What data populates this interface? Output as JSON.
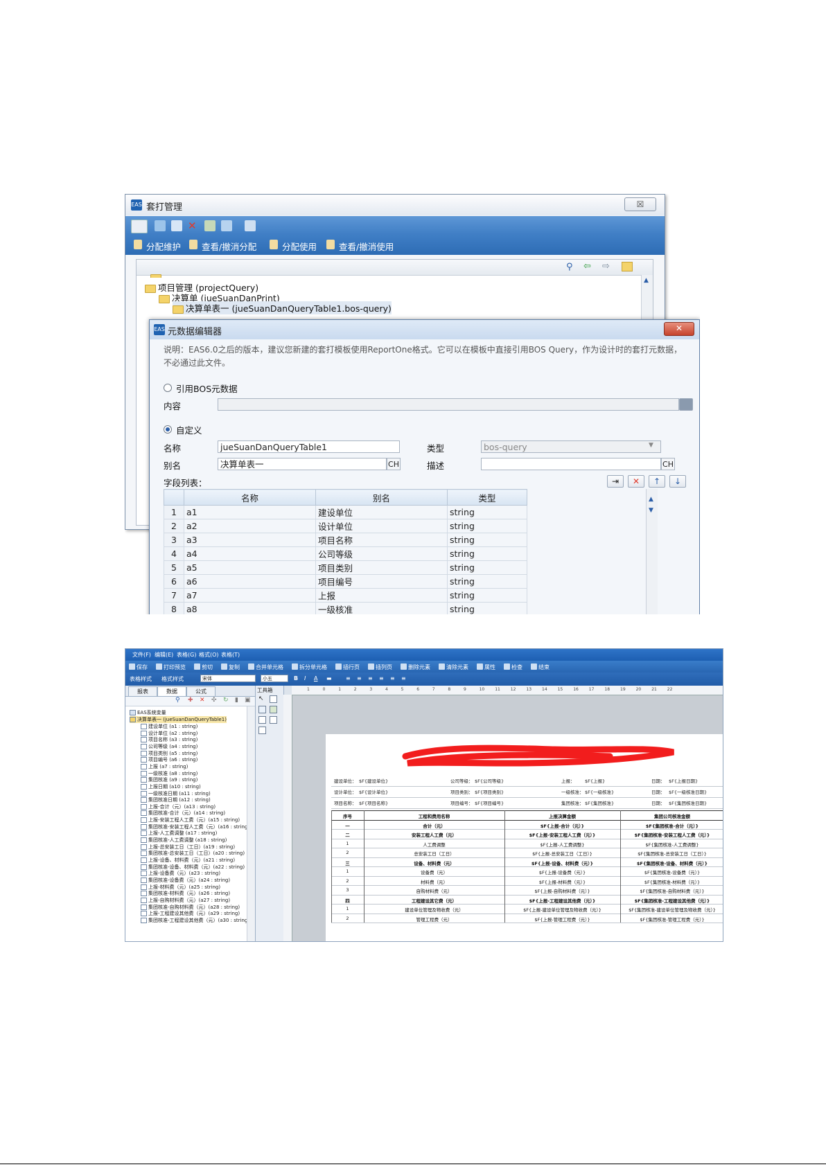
{
  "win1": {
    "title": "套打管理",
    "close": "☒",
    "actions": [
      "分配维护",
      "查看/撤消分配",
      "分配使用",
      "查看/撤消使用"
    ],
    "tree": [
      {
        "indent": 0,
        "label": "项目管理 (projectQuery)"
      },
      {
        "indent": 1,
        "label": "决算单 (jueSuanDanPrint)"
      },
      {
        "indent": 2,
        "label": "决算单表一 (jueSuanDanQueryTable1.bos-query)",
        "selected": true
      }
    ]
  },
  "dialog": {
    "title": "元数据编辑器",
    "description": "说明：EAS6.0之后的版本，建议您新建的套打模板使用ReportOne格式。它可以在模板中直接引用BOS Query，作为设计时的套打元数据，不必通过此文件。",
    "ref_bos_label": "引用BOS元数据",
    "content_label": "内容",
    "custom_label": "自定义",
    "name_label": "名称",
    "name_value": "jueSuanDanQueryTable1",
    "type_label": "类型",
    "type_value": "bos-query",
    "alias_label": "别名",
    "alias_value": "决算单表一",
    "desc_label": "描述",
    "ch": "CH",
    "fields_label": "字段列表：",
    "columns": [
      "名称",
      "别名",
      "类型"
    ],
    "rows": [
      [
        "1",
        "a1",
        "建设单位",
        "string"
      ],
      [
        "2",
        "a2",
        "设计单位",
        "string"
      ],
      [
        "3",
        "a3",
        "项目名称",
        "string"
      ],
      [
        "4",
        "a4",
        "公司等级",
        "string"
      ],
      [
        "5",
        "a5",
        "项目类别",
        "string"
      ],
      [
        "6",
        "a6",
        "项目编号",
        "string"
      ],
      [
        "7",
        "a7",
        "上报",
        "string"
      ],
      [
        "8",
        "a8",
        "一级核准",
        "string"
      ]
    ]
  },
  "editor": {
    "menus": [
      "文件(F)",
      "编辑(E)",
      "表格(G)",
      "格式(O)",
      "表格(T)"
    ],
    "toolbar1": [
      "保存",
      "打印预览",
      "剪切",
      "复制",
      "合并单元格",
      "拆分单元格",
      "插行页",
      "插列页",
      "删除元素",
      "清除元素",
      "属性",
      "检查",
      "结束"
    ],
    "toolbar2": {
      "style": "表格样式",
      "brush": "格式样式",
      "font": "宋体",
      "size": "小五"
    },
    "left_tabs": [
      "报表",
      "数据",
      "公式"
    ],
    "toolbox_label": "工具箱",
    "tree_root": "EAS系统变量",
    "tree_table": "决算单表一 (jueSuanDanQueryTable1)",
    "tree_items": [
      "建设单位 (a1 : string)",
      "设计单位 (a2 : string)",
      "项目名称 (a3 : string)",
      "公司等级 (a4 : string)",
      "项目类别 (a5 : string)",
      "项目编号 (a6 : string)",
      "上报 (a7 : string)",
      "一级核准 (a8 : string)",
      "集团核准 (a9 : string)",
      "上报日期 (a10 : string)",
      "一级核准日期 (a11 : string)",
      "集团核准日期 (a12 : string)",
      "上报-合计（元）(a13 : string)",
      "集团核准-合计（元）(a14 : string)",
      "上报-安装工程人工费（元）(a15 : string)",
      "集团核准-安装工程人工费（元）(a16 : string)",
      "上报-人工费调整 (a17 : string)",
      "集团核准-人工费调整 (a18 : string)",
      "上报-总安装工日（工日）(a19 : string)",
      "集团核准-总安装工日（工日）(a20 : string)",
      "上报-设备、材料费（元）(a21 : string)",
      "集团核准-设备、材料费（元）(a22 : string)",
      "上报-设备费（元）(a23 : string)",
      "集团核准-设备费（元）(a24 : string)",
      "上报-材料费（元）(a25 : string)",
      "集团核准-材料费（元）(a26 : string)",
      "上报-自购材料费（元）(a27 : string)",
      "集团核准-自购材料费（元）(a28 : string)",
      "上报-工程建设其他费（元）(a29 : string)",
      "集团核准-工程建设其他费（元）(a30 : string)"
    ],
    "ruler": [
      "1",
      "0",
      "1",
      "2",
      "3",
      "4",
      "5",
      "6",
      "7",
      "8",
      "9",
      "10",
      "11",
      "12",
      "13",
      "14",
      "15",
      "16",
      "17",
      "18",
      "19",
      "20",
      "21",
      "22"
    ],
    "info_rows": [
      [
        "建设单位：",
        "$F{建设单位}",
        "公司等级：",
        "$F{公司等级}",
        "上报：",
        "$F{上报}",
        "日期：",
        "$F{上报日期}"
      ],
      [
        "设计单位：",
        "$F{设计单位}",
        "项目类别：",
        "$F{项目类别}",
        "一级核准：",
        "$F{一级核准}",
        "日期：",
        "$F{一级核准日期}"
      ],
      [
        "项目名称：",
        "$F{项目名称}",
        "项目编号：",
        "$F{项目编号}",
        "集团核准：",
        "$F{集团核准}",
        "日期：",
        "$F{集团核准日期}"
      ]
    ],
    "table_header": [
      "序号",
      "工程和费用名称",
      "上报决算金额",
      "集团公司核准金额"
    ],
    "table_rows": [
      [
        "一",
        "合计（元）",
        "$F{上报-合计（元）}",
        "$F{集团核准-合计（元）}",
        true
      ],
      [
        "二",
        "安装工程人工费（元）",
        "$F{上报-安装工程人工费（元）}",
        "$F{集团核准-安装工程人工费（元）}",
        true
      ],
      [
        "1",
        "人工费调整",
        "$F{上报-人工费调整}",
        "$F{集团核准-人工费调整}",
        false
      ],
      [
        "2",
        "总安装工日（工日）",
        "$F{上报-总安装工日（工日）}",
        "$F{集团核准-总安装工日（工日）}",
        false
      ],
      [
        "三",
        "设备、材料费（元）",
        "$F{上报-设备、材料费（元）}",
        "$F{集团核准-设备、材料费（元）}",
        true
      ],
      [
        "1",
        "设备费（元）",
        "$F{上报-设备费（元）}",
        "$F{集团核准-设备费（元）}",
        false
      ],
      [
        "2",
        "材料费（元）",
        "$F{上报-材料费（元）}",
        "$F{集团核准-材料费（元）}",
        false
      ],
      [
        "3",
        "自购材料费（元）",
        "$F{上报-自购材料费（元）}",
        "$F{集团核准-自购材料费（元）}",
        false
      ],
      [
        "四",
        "工程建设其它费（元）",
        "$F{上报-工程建设其他费（元）}",
        "$F{集团核准-工程建设其他费（元）}",
        true
      ],
      [
        "1",
        "建设单位管理及物收费（元）",
        "$F{上报-建设单位管理及物收费（元）}",
        "$F{集团核准-建设单位管理及物收费（元）}",
        false
      ],
      [
        "2",
        "管理工程费（元）",
        "$F{上报-管理工程费（元）}",
        "$F{集团核准-管理工程费（元）}",
        false
      ]
    ]
  }
}
